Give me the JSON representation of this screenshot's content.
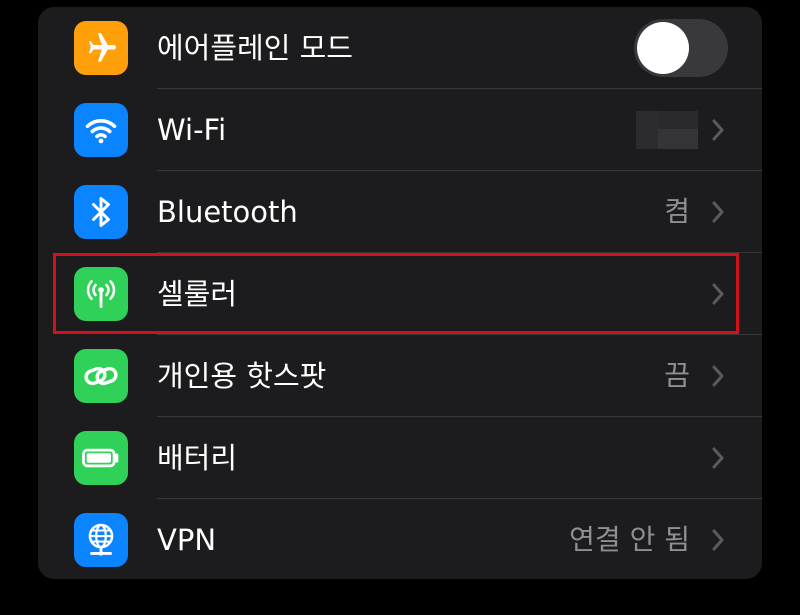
{
  "settings": {
    "rows": [
      {
        "id": "airplane",
        "label": "에어플레인 모드",
        "icon": "airplane-icon",
        "icon_color": "#ff9f0a",
        "control": "toggle",
        "toggle_on": false
      },
      {
        "id": "wifi",
        "label": "Wi-Fi",
        "icon": "wifi-icon",
        "icon_color": "#0a84ff",
        "value": ""
      },
      {
        "id": "bluetooth",
        "label": "Bluetooth",
        "icon": "bluetooth-icon",
        "icon_color": "#0a84ff",
        "value": "켬"
      },
      {
        "id": "cellular",
        "label": "셀룰러",
        "icon": "antenna-icon",
        "icon_color": "#30d158",
        "value": ""
      },
      {
        "id": "hotspot",
        "label": "개인용 핫스팟",
        "icon": "link-icon",
        "icon_color": "#30d158",
        "value": "끔"
      },
      {
        "id": "battery",
        "label": "배터리",
        "icon": "battery-icon",
        "icon_color": "#30d158",
        "value": ""
      },
      {
        "id": "vpn",
        "label": "VPN",
        "icon": "globe-icon",
        "icon_color": "#0a84ff",
        "value": "연결 안 됨"
      }
    ]
  },
  "annotation": {
    "highlight_color": "#d1121e"
  }
}
